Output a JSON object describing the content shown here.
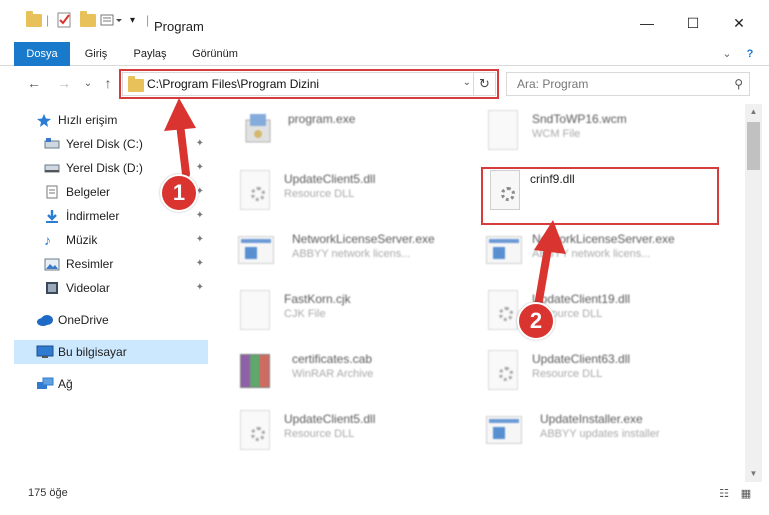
{
  "window": {
    "title": "Program",
    "controls": {
      "minimize": "—",
      "maximize": "☐",
      "close": "✕"
    }
  },
  "ribbon": {
    "tabs": [
      "Dosya",
      "Giriş",
      "Paylaş",
      "Görünüm"
    ],
    "active_tab": "Dosya",
    "expand": "⌄",
    "help": "?"
  },
  "nav": {
    "back": "←",
    "forward": "→",
    "recent": "⌄",
    "up": "↑"
  },
  "address": {
    "path": "C:\\Program Files\\Program Dizini",
    "dropdown": "⌄",
    "refresh": "↻"
  },
  "search": {
    "placeholder": "Ara: Program",
    "icon": "⚲"
  },
  "sidebar": {
    "items": [
      {
        "label": "Hızlı erişim",
        "icon": "star-icon",
        "pinned": false,
        "selected": false
      },
      {
        "label": "Yerel Disk (C:)",
        "icon": "drive-icon",
        "pinned": true,
        "selected": false
      },
      {
        "label": "Yerel Disk (D:)",
        "icon": "drive-icon",
        "pinned": true,
        "selected": false
      },
      {
        "label": "Belgeler",
        "icon": "documents-icon",
        "pinned": true,
        "selected": false
      },
      {
        "label": "İndirmeler",
        "icon": "download-icon",
        "pinned": true,
        "selected": false
      },
      {
        "label": "Müzik",
        "icon": "music-icon",
        "pinned": true,
        "selected": false
      },
      {
        "label": "Resimler",
        "icon": "pictures-icon",
        "pinned": true,
        "selected": false
      },
      {
        "label": "Videolar",
        "icon": "videos-icon",
        "pinned": true,
        "selected": false
      },
      {
        "label": "OneDrive",
        "icon": "cloud-icon",
        "pinned": false,
        "selected": false
      },
      {
        "label": "Bu bilgisayar",
        "icon": "computer-icon",
        "pinned": false,
        "selected": true
      },
      {
        "label": "Ağ",
        "icon": "network-icon",
        "pinned": false,
        "selected": false
      }
    ],
    "pin_glyph": "📌"
  },
  "files": [
    {
      "name": "program.exe",
      "desc": "",
      "icon": "installer-icon"
    },
    {
      "name": "SndToWP16.wcm",
      "desc": "WCM File",
      "icon": "document-icon"
    },
    {
      "name": "UpdateClient5.dll",
      "desc": "Resource DLL",
      "icon": "dll-gear-icon"
    },
    {
      "name": "crinf9.dll",
      "desc": "",
      "icon": "dll-gear-icon",
      "highlighted": true
    },
    {
      "name": "NetworkLicenseServer.exe",
      "desc": "ABBYY network licens...",
      "icon": "exe-window-icon"
    },
    {
      "name": "NetworkLicenseServer.exe",
      "desc": "ABBYY network licens...",
      "icon": "exe-window-icon"
    },
    {
      "name": "FastKorn.cjk",
      "desc": "CJK File",
      "icon": "document-icon"
    },
    {
      "name": "UpdateClient19.dll",
      "desc": "Resource DLL",
      "icon": "dll-gear-icon"
    },
    {
      "name": "certificates.cab",
      "desc": "WinRAR Archive",
      "icon": "winrar-icon"
    },
    {
      "name": "UpdateClient63.dll",
      "desc": "Resource DLL",
      "icon": "dll-gear-icon"
    },
    {
      "name": "UpdateClient5.dll",
      "desc": "Resource DLL",
      "icon": "dll-gear-icon"
    },
    {
      "name": "UpdateInstaller.exe",
      "desc": "ABBYY updates installer",
      "icon": "exe-window-icon"
    }
  ],
  "annotations": {
    "badge1": "1",
    "badge2": "2",
    "color": "#d9342f"
  },
  "status": {
    "count": "175 öğe",
    "details_view": "☷",
    "icons_view": "▦"
  },
  "colors": {
    "accent": "#1979ca",
    "selection": "#cce8ff",
    "highlight_box": "#d83b3b"
  }
}
